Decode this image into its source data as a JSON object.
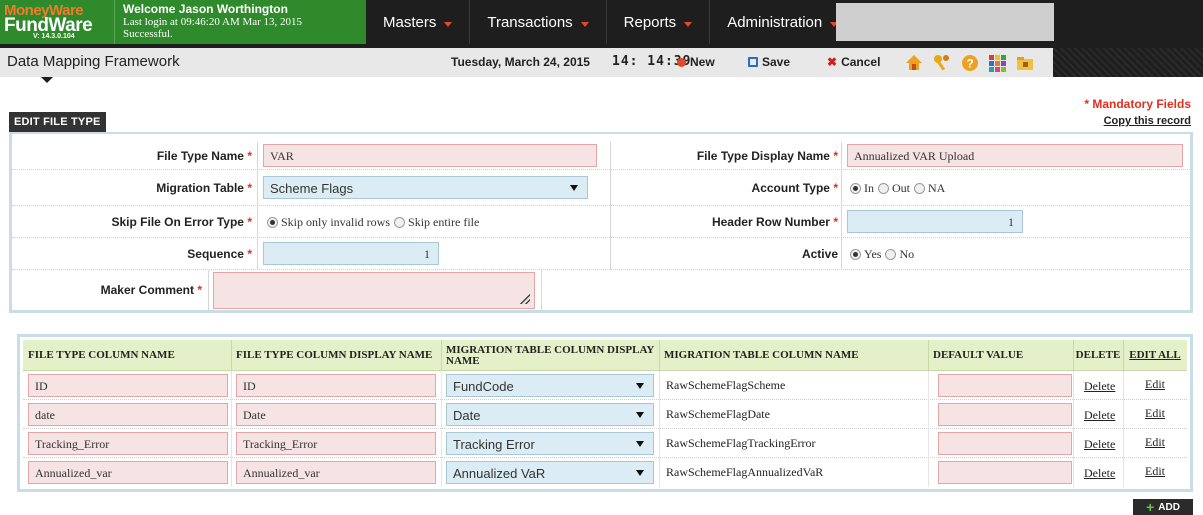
{
  "app": {
    "brand_line1": "MoneyWare",
    "brand_line2": "FundWare",
    "version": "V: 14.3.0.104"
  },
  "welcome": {
    "title": "Welcome Jason Worthington",
    "last_login": "Last login at 09:46:20 AM Mar 13, 2015",
    "status": "Successful."
  },
  "nav": {
    "items": [
      {
        "label": "Masters"
      },
      {
        "label": "Transactions"
      },
      {
        "label": "Reports"
      },
      {
        "label": "Administration"
      }
    ]
  },
  "subbar": {
    "module_title": "Data Mapping Framework",
    "date": "Tuesday, March 24, 2015",
    "clock": "14: 14:39",
    "new_label": "New",
    "save_label": "Save",
    "cancel_label": "Cancel"
  },
  "toolbar_icons": [
    "home-icon",
    "keys-icon",
    "help-icon",
    "apps-grid-icon",
    "folder-lock-icon"
  ],
  "section": {
    "title": "EDIT FILE TYPE",
    "mandatory_note": "* Mandatory Fields",
    "copy_record": "Copy this record"
  },
  "form": {
    "file_type_name": {
      "label": "File Type Name",
      "value": "VAR"
    },
    "file_type_display_name": {
      "label": "File Type Display Name",
      "value": "Annualized VAR Upload"
    },
    "migration_table": {
      "label": "Migration Table",
      "value": "Scheme Flags"
    },
    "account_type": {
      "label": "Account Type",
      "options": [
        "In",
        "Out",
        "NA"
      ],
      "selected": "In"
    },
    "skip_file_on_error_type": {
      "label": "Skip File On Error Type",
      "options": [
        "Skip only invalid rows",
        "Skip entire file"
      ],
      "selected": "Skip only invalid rows"
    },
    "header_row_number": {
      "label": "Header Row Number",
      "value": "1"
    },
    "sequence": {
      "label": "Sequence",
      "value": "1"
    },
    "active": {
      "label": "Active",
      "options": [
        "Yes",
        "No"
      ],
      "selected": "Yes"
    },
    "maker_comment": {
      "label": "Maker Comment",
      "value": ""
    }
  },
  "grid": {
    "headers": {
      "file_type_column_name": "FILE TYPE COLUMN NAME",
      "file_type_column_display_name": "FILE TYPE COLUMN DISPLAY NAME",
      "migration_table_column_display_name": "MIGRATION TABLE COLUMN DISPLAY NAME",
      "migration_table_column_name": "MIGRATION TABLE COLUMN NAME",
      "default_value": "DEFAULT VALUE",
      "delete": "DELETE",
      "edit_all": "EDIT ALL"
    },
    "rows": [
      {
        "col_name": "ID",
        "display_name": "ID",
        "mig_display": "FundCode",
        "mig_name": "RawSchemeFlagScheme",
        "default_value": "",
        "delete": "Delete",
        "edit": "Edit"
      },
      {
        "col_name": "date",
        "display_name": "Date",
        "mig_display": "Date",
        "mig_name": "RawSchemeFlagDate",
        "default_value": "",
        "delete": "Delete",
        "edit": "Edit"
      },
      {
        "col_name": "Tracking_Error",
        "display_name": "Tracking_Error",
        "mig_display": "Tracking Error",
        "mig_name": "RawSchemeFlagTrackingError",
        "default_value": "",
        "delete": "Delete",
        "edit": "Edit"
      },
      {
        "col_name": "Annualized_var",
        "display_name": "Annualized_var",
        "mig_display": "Annualized VaR",
        "mig_name": "RawSchemeFlagAnnualizedVaR",
        "default_value": "",
        "delete": "Delete",
        "edit": "Edit"
      }
    ],
    "add_label": "ADD"
  },
  "colors": {
    "brand_green": "#2f8a2c",
    "brand_orange": "#f07b2a",
    "topbar": "#1e1e1e",
    "required_red": "#e0301e",
    "grid_header": "#e4f0c8",
    "input_blue": "#dcecf4",
    "input_pink": "#f6e3e3"
  }
}
